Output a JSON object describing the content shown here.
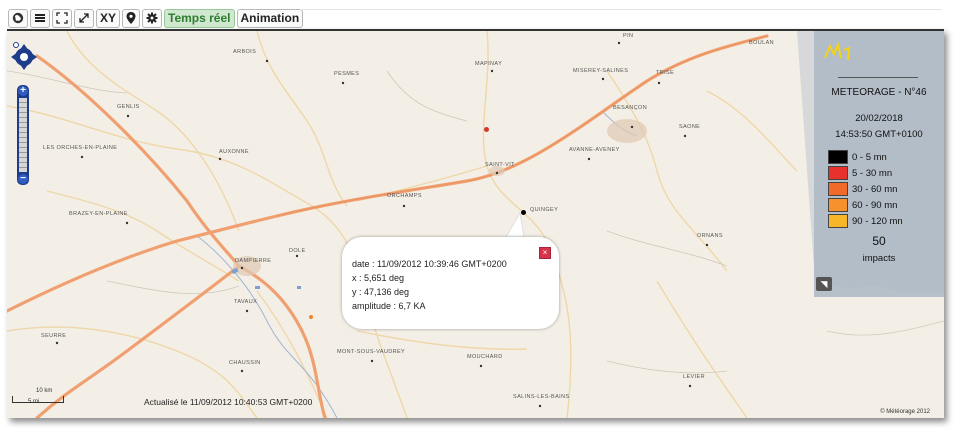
{
  "toolbar": {
    "icons": [
      "globe-icon",
      "layers-icon",
      "fit-extent-icon",
      "fullscreen-icon",
      "crosshair-icon",
      "gear-icon"
    ],
    "xy_label": "XY",
    "temps_reel_label": "Temps réel",
    "animation_label": "Animation"
  },
  "map": {
    "places": [
      "BOULAN",
      "PIN",
      "MAPINAY",
      "MISEREY-SALINES",
      "TRISE",
      "BESANÇON",
      "SAONE",
      "AVANNE-AVENEY",
      "SAINT-VIT",
      "ORCHAMPS",
      "DAMPIERRE",
      "DOLE",
      "TAVAUX",
      "CHAUSSIN",
      "MONT-SOUS-VAUDREY",
      "MOUCHARD",
      "SALINS-LES-BAINS",
      "GENLIS",
      "AUXONNE",
      "PESMES",
      "BRAZEY-EN-PLAINE",
      "LES ORCHES-EN-PLAINE",
      "SEURRE",
      "ORNANS",
      "QUINGEY",
      "LEVIER",
      "ARBOIS"
    ],
    "attribution": "© Météorage 2012",
    "update_text": "Actualisé le 11/09/2012 10:40:53 GMT+0200",
    "scale_km": "10 km",
    "scale_mi": "5 mi"
  },
  "legend": {
    "title": "METEORAGE - N°46",
    "date": "20/02/2018",
    "time": "14:53:50 GMT+0100",
    "bins": [
      {
        "label": "0 - 5 mn",
        "color": "#000000"
      },
      {
        "label": "5 - 30 mn",
        "color": "#e8312c"
      },
      {
        "label": "30 - 60 mn",
        "color": "#f26a2a"
      },
      {
        "label": "60 - 90 mn",
        "color": "#f6922e"
      },
      {
        "label": "90 - 120 mn",
        "color": "#f7b628"
      }
    ],
    "count": "50",
    "impacts_label": "impacts"
  },
  "popup": {
    "date_line": "date : 11/09/2012 10:39:46 GMT+0200",
    "x_line": "x : 5,651 deg",
    "y_line": "y : 47,136 deg",
    "amplitude_line": "amplitude : 6,7 KA"
  },
  "markers": [
    {
      "name": "impact-marker-black",
      "color": "#000000"
    },
    {
      "name": "impact-marker-red",
      "color": "#d23a28"
    },
    {
      "name": "impact-marker-orange",
      "color": "#f2822e"
    }
  ]
}
